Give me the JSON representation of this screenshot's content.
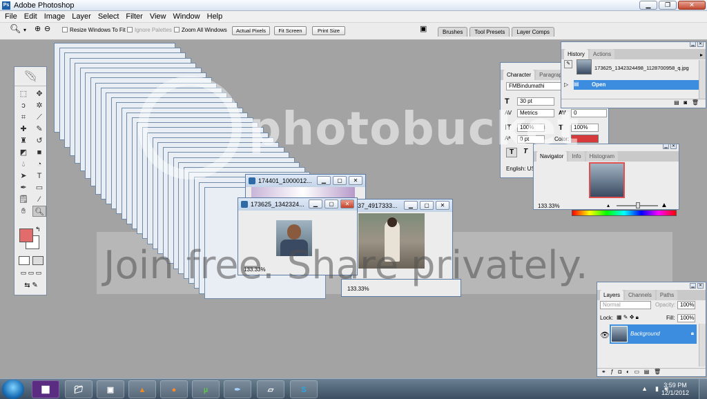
{
  "window": {
    "title": "Adobe Photoshop",
    "icon": "ps-icon",
    "controls": [
      "minimize",
      "maximize",
      "close"
    ]
  },
  "menu": [
    "File",
    "Edit",
    "Image",
    "Layer",
    "Select",
    "Filter",
    "View",
    "Window",
    "Help"
  ],
  "options_bar": {
    "resize_windows": "Resize Windows To Fit",
    "ignore_palettes": "Ignore Palettes",
    "zoom_all": "Zoom All Windows",
    "actual_pixels": "Actual Pixels",
    "fit_screen": "Fit Screen",
    "print_size": "Print Size"
  },
  "palette_well": [
    "Brushes",
    "Tool Presets",
    "Layer Comps"
  ],
  "doc_windows": [
    {
      "title": "174401_1000012...",
      "zoom": ""
    },
    {
      "title": "173625_1342324...",
      "zoom": "133.33%"
    },
    {
      "title": "437_4917333...",
      "zoom": "133.33%"
    }
  ],
  "character_panel": {
    "tabs": [
      "Character",
      "Paragraph"
    ],
    "font": "FMBindumathi",
    "size": "30 pt",
    "kerning": "Metrics",
    "tracking": "0",
    "vscale": "100%",
    "hscale": "100%",
    "baseline": "0 pt",
    "color_label": "Color:",
    "color": "#d63a3a",
    "language": "English: US"
  },
  "history_panel": {
    "tabs": [
      "History",
      "Actions"
    ],
    "snapshot": "173625_1342324498_1128700958_q.jpg",
    "step": "Open"
  },
  "navigator_panel": {
    "tabs": [
      "Navigator",
      "Info",
      "Histogram"
    ],
    "zoom": "133.33%"
  },
  "layers_panel": {
    "tabs": [
      "Layers",
      "Channels",
      "Paths"
    ],
    "blend": "Normal",
    "opacity_label": "Opacity:",
    "opacity": "100%",
    "lock_label": "Lock:",
    "fill_label": "Fill:",
    "fill": "100%",
    "layer": "Background"
  },
  "watermark": {
    "logo": "photobucket",
    "tagline": "Join free. Share privately."
  },
  "taskbar": {
    "apps": [
      "windows-start",
      "calc-app",
      "explorer",
      "media-app",
      "vlc",
      "firefox",
      "utorrent",
      "photoshop",
      "notepad",
      "skype"
    ],
    "time": "3:59 PM",
    "date": "12/1/2012"
  }
}
